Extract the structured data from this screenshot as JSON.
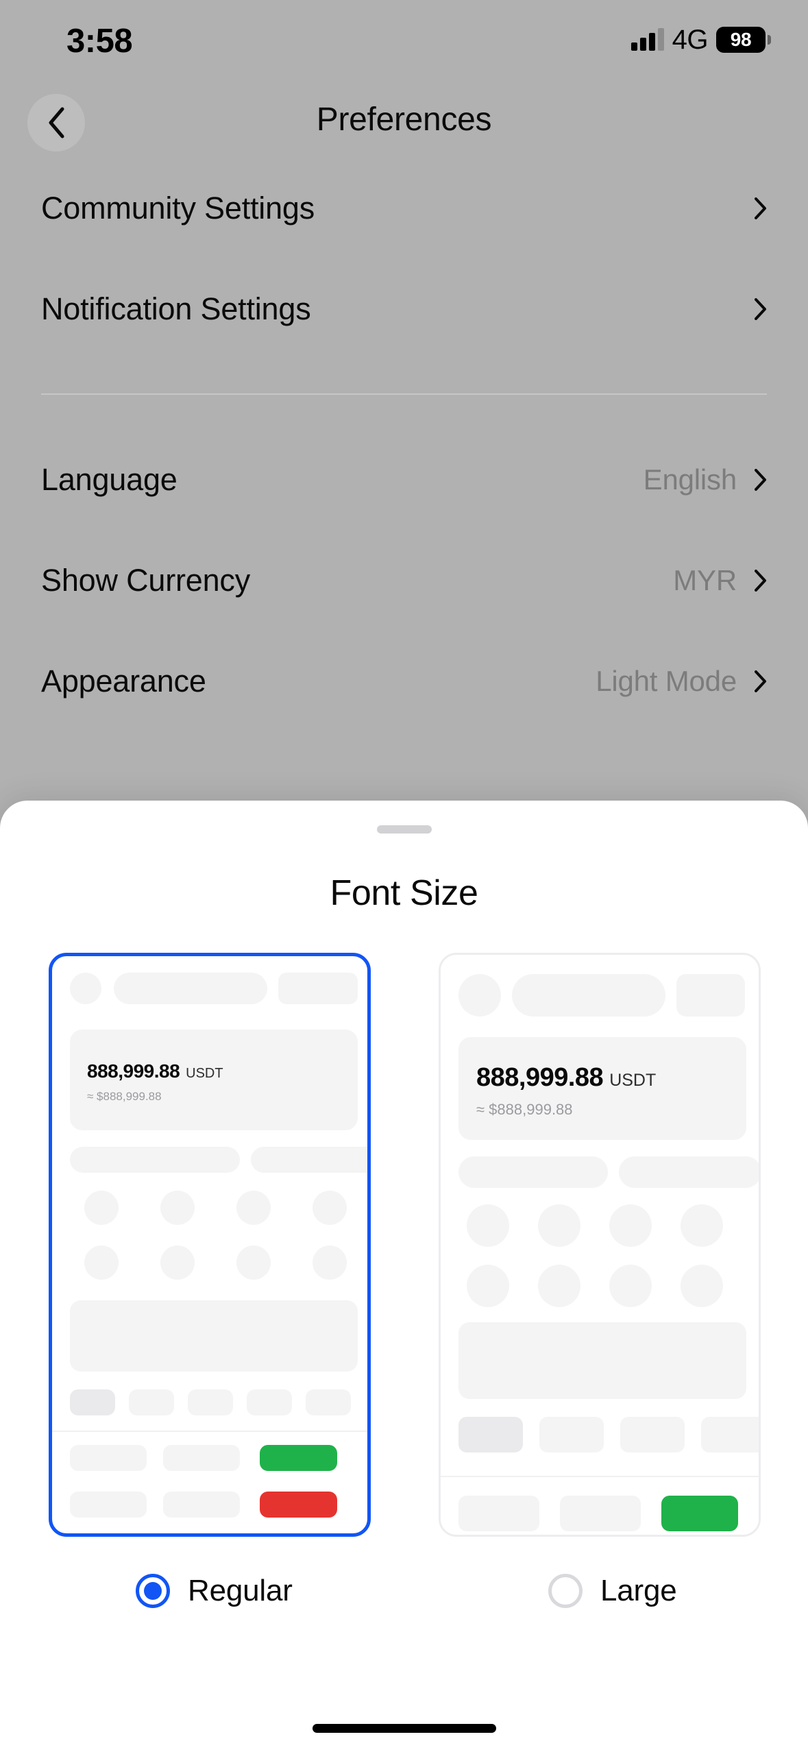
{
  "status_bar": {
    "time": "3:58",
    "network_type": "4G",
    "battery_level": "98",
    "signal_icon": "signal-bars-icon"
  },
  "nav": {
    "back_icon": "chevron-left-icon",
    "title": "Preferences"
  },
  "settings": {
    "group_one": [
      {
        "label": "Community Settings",
        "value": "",
        "chevron": "chevron-right-icon"
      },
      {
        "label": "Notification Settings",
        "value": "",
        "chevron": "chevron-right-icon"
      }
    ],
    "group_two": [
      {
        "label": "Language",
        "value": "English",
        "chevron": "chevron-right-icon"
      },
      {
        "label": "Show Currency",
        "value": "MYR",
        "chevron": "chevron-right-icon"
      },
      {
        "label": "Appearance",
        "value": "Light Mode",
        "chevron": "chevron-right-icon"
      }
    ]
  },
  "sheet": {
    "grabber": "drag-handle",
    "title": "Font Size",
    "preview_regular": {
      "amount": "888,999.88",
      "unit": "USDT",
      "approx": "≈ $888,999.88"
    },
    "preview_large": {
      "amount": "888,999.88",
      "unit": "USDT",
      "approx": "≈ $888,999.88"
    },
    "options": [
      {
        "label": "Regular",
        "selected": true
      },
      {
        "label": "Large",
        "selected": false
      }
    ]
  },
  "colors": {
    "accent_blue": "#1155F5",
    "positive_green": "#1FB24A",
    "negative_red": "#E5342F",
    "sheet_background": "#FFFFFF",
    "dimmed_background": "#B1B1B1",
    "skeleton_gray": "#F4F4F5"
  }
}
